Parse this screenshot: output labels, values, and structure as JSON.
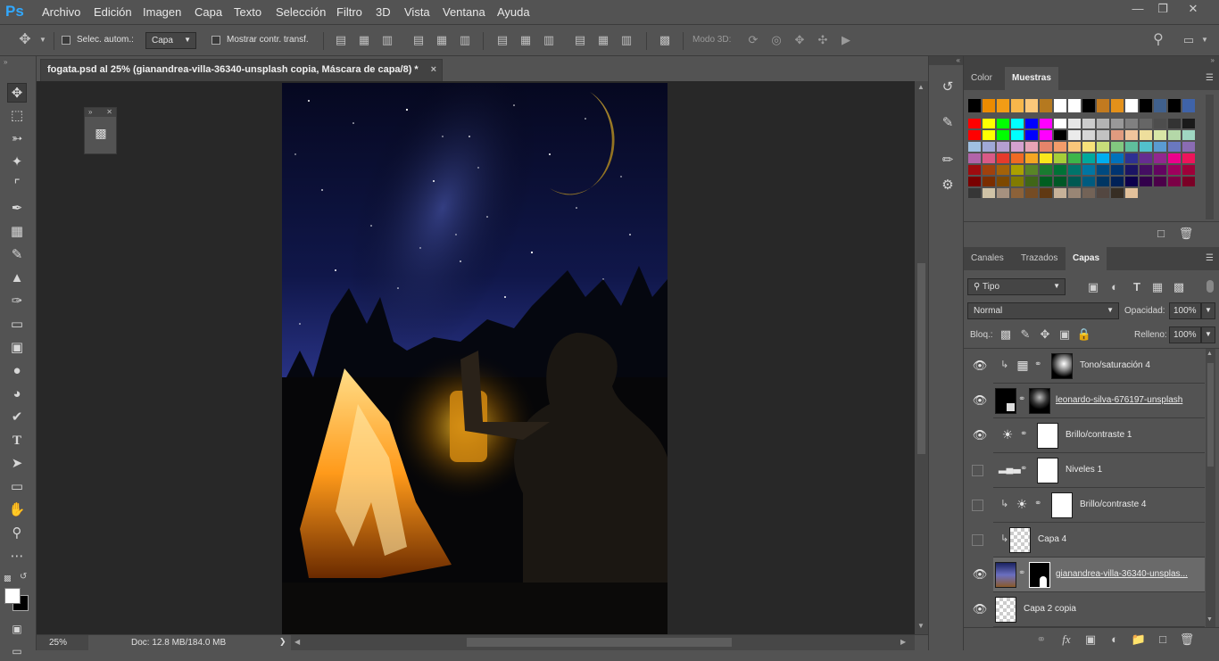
{
  "app": {
    "logo": "Ps"
  },
  "menu": [
    "Archivo",
    "Edición",
    "Imagen",
    "Capa",
    "Texto",
    "Selección",
    "Filtro",
    "3D",
    "Vista",
    "Ventana",
    "Ayuda"
  ],
  "options": {
    "auto_select_label": "Selec. autom.:",
    "auto_select_value": "Capa",
    "show_transform_label": "Mostrar contr. transf.",
    "mode3d_label": "Modo 3D:"
  },
  "document": {
    "tab_title": "fogata.psd al 25% (gianandrea-villa-36340-unsplash copia, Máscara de capa/8) *",
    "close": "×"
  },
  "status": {
    "zoom": "25%",
    "doc_info": "Doc: 12.8 MB/184.0 MB",
    "arrow": "❯"
  },
  "swatches_panel": {
    "tabs": [
      "Color",
      "Muestras"
    ],
    "active_tab": "Muestras",
    "rows": [
      [
        "#000000",
        "#ec8b00",
        "#f29c15",
        "#f7b74b",
        "#fcc87a",
        "#b5791f",
        "#ffffff",
        "#fefefe",
        "#000000",
        "#c27a1f",
        "#e4911a",
        "#ffffff",
        "#000000",
        "#40608c",
        "#000000",
        "#3f63a8"
      ],
      [
        "#ff0000",
        "#ffff00",
        "#00ff00",
        "#00ffff",
        "#0000ff",
        "#ff00ff",
        "#ffffff",
        "#e6e6e6",
        "#cccccc",
        "#b3b3b3",
        "#999999",
        "#808080",
        "#666666",
        "#4d4d4d",
        "#333333",
        "#1a1a1a"
      ],
      [
        "#ff0000",
        "#ffff00",
        "#00ff00",
        "#00ffff",
        "#0000ff",
        "#ff00ff",
        "#000000",
        "#ebebeb",
        "#d6d6d6",
        "#c2c2c2",
        "#e09b7f",
        "#f0c49c",
        "#eede9c",
        "#d8e6a6",
        "#b4d8a8",
        "#9fd6c2"
      ],
      [
        "#9fc0e2",
        "#9fa8d6",
        "#b49fd0",
        "#d5a1cf",
        "#e7a3b5",
        "#e6846a",
        "#f29c6a",
        "#f8c67a",
        "#f7e17a",
        "#c8dd7a",
        "#82c87f",
        "#5fbe9c",
        "#52c1cd",
        "#5a9bd2",
        "#6a78bf",
        "#8a6cb3"
      ],
      [
        "#b164a9",
        "#d95a87",
        "#e53a2c",
        "#ef6a24",
        "#f5a623",
        "#f8e71c",
        "#a6ce39",
        "#3db54a",
        "#00a99d",
        "#00aeef",
        "#0072bc",
        "#2e3192",
        "#662d91",
        "#92278f",
        "#ec008c",
        "#ed145b"
      ],
      [
        "#9e0b0f",
        "#a0410d",
        "#a36209",
        "#aba000",
        "#598527",
        "#197b30",
        "#007236",
        "#00746b",
        "#0076a3",
        "#004a80",
        "#003471",
        "#1b1464",
        "#440e62",
        "#630460",
        "#9e005d",
        "#9e0039"
      ],
      [
        "#790000",
        "#7b2e00",
        "#7d4900",
        "#827b00",
        "#406618",
        "#005e20",
        "#005826",
        "#005952",
        "#005b7f",
        "#003663",
        "#002157",
        "#0d004c",
        "#32004b",
        "#4b0049",
        "#7b0046",
        "#7a0026"
      ],
      [
        "#363636",
        "#d0c3a7",
        "#a6917f",
        "#8c6239",
        "#754c24",
        "#603913",
        "#c7b299",
        "#998675",
        "#736357",
        "#534741",
        "#372e24",
        "#e3c19b"
      ]
    ]
  },
  "layers_panel": {
    "tabs": [
      "Canales",
      "Trazados",
      "Capas"
    ],
    "active_tab": "Capas",
    "filter_label": "Tipo",
    "blend_mode": "Normal",
    "opacity_label": "Opacidad:",
    "opacity_value": "100%",
    "lock_label": "Bloq.:",
    "fill_label": "Relleno:",
    "fill_value": "100%",
    "layers": [
      {
        "name": "Tono/saturación 4",
        "visible": true,
        "clipped": true,
        "type": "hue-saturation"
      },
      {
        "name": "leonardo-silva-676197-unsplash",
        "visible": true,
        "clipped": false,
        "type": "image-mask"
      },
      {
        "name": "Brillo/contraste 1",
        "visible": true,
        "clipped": false,
        "type": "brightness"
      },
      {
        "name": "Niveles 1",
        "visible": false,
        "clipped": false,
        "type": "levels"
      },
      {
        "name": "Brillo/contraste 4",
        "visible": false,
        "clipped": true,
        "type": "brightness"
      },
      {
        "name": "Capa 4",
        "visible": false,
        "clipped": true,
        "type": "transparent"
      },
      {
        "name": "gianandrea-villa-36340-unsplas...",
        "visible": true,
        "clipped": false,
        "type": "photo-mask",
        "active": true
      },
      {
        "name": "Capa 2 copia",
        "visible": true,
        "clipped": false,
        "type": "transparent"
      }
    ]
  }
}
